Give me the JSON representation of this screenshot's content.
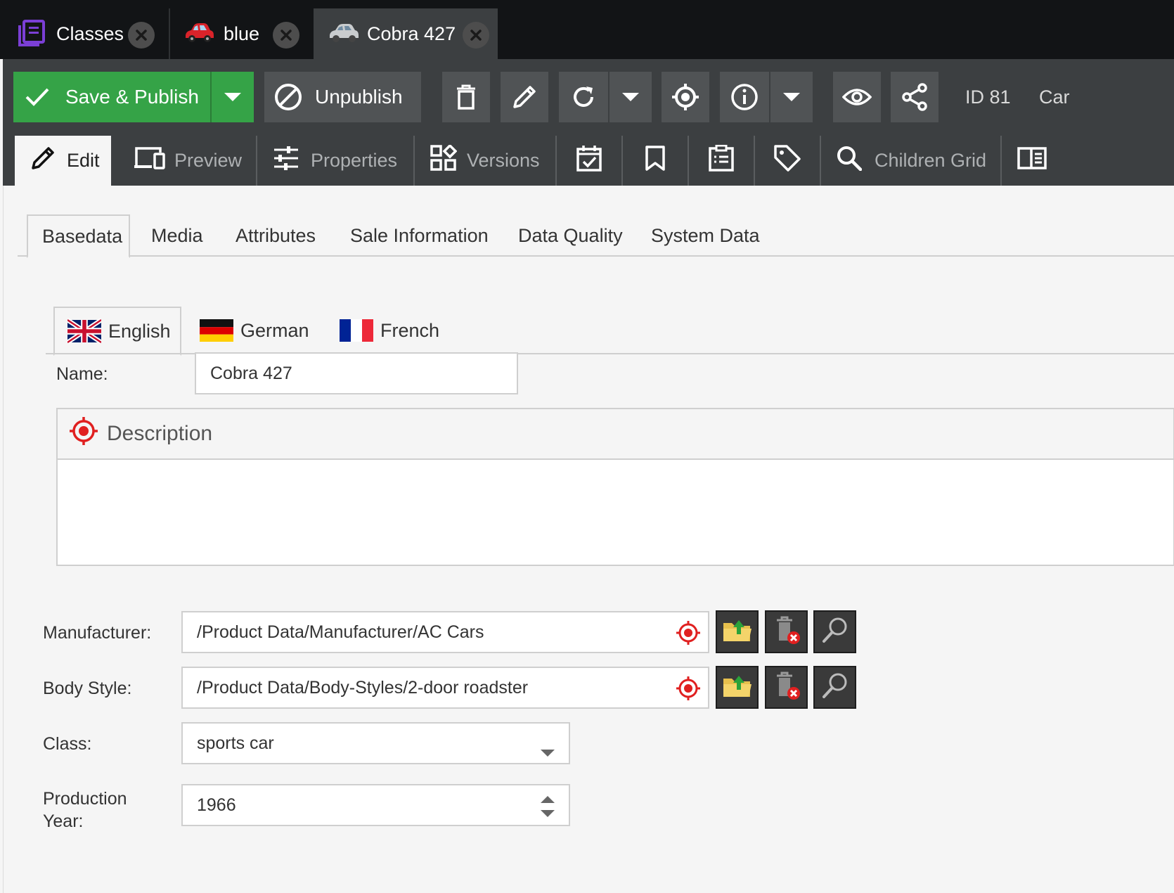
{
  "tabs": [
    {
      "label": "Classes",
      "icon": "classes-icon"
    },
    {
      "label": "blue",
      "icon": "red-car-icon"
    },
    {
      "label": "Cobra 427",
      "icon": "grey-car-icon",
      "active": true
    }
  ],
  "toolbar": {
    "save_publish_label": "Save & Publish",
    "unpublish_label": "Unpublish",
    "id_text": "ID 81",
    "class_text": "Car",
    "accent_color": "#35a347"
  },
  "mode_tabs": [
    {
      "label": "Edit",
      "icon": "pencil-icon",
      "active": true
    },
    {
      "label": "Preview",
      "icon": "devices-icon"
    },
    {
      "label": "Properties",
      "icon": "sliders-icon"
    },
    {
      "label": "Versions",
      "icon": "versions-icon"
    },
    {
      "label": "",
      "icon": "calendar-check-icon"
    },
    {
      "label": "",
      "icon": "bookmark-icon"
    },
    {
      "label": "",
      "icon": "clipboard-list-icon"
    },
    {
      "label": "",
      "icon": "tag-icon"
    },
    {
      "label": "Children Grid",
      "icon": "search-icon"
    },
    {
      "label": "",
      "icon": "split-view-icon"
    }
  ],
  "sub_tabs": [
    "Basedata",
    "Media",
    "Attributes",
    "Sale Information",
    "Data Quality",
    "System Data"
  ],
  "lang_tabs": [
    "English",
    "German",
    "French"
  ],
  "form": {
    "name_label": "Name:",
    "name_value": "Cobra 427",
    "description_title": "Description",
    "manufacturer_label": "Manufacturer:",
    "manufacturer_value": "/Product Data/Manufacturer/AC Cars",
    "bodystyle_label": "Body Style:",
    "bodystyle_value": "/Product Data/Body-Styles/2-door roadster",
    "class_label": "Class:",
    "class_value": "sports car",
    "year_label_line1": "Production",
    "year_label_line2": "Year:",
    "year_value": "1966"
  }
}
